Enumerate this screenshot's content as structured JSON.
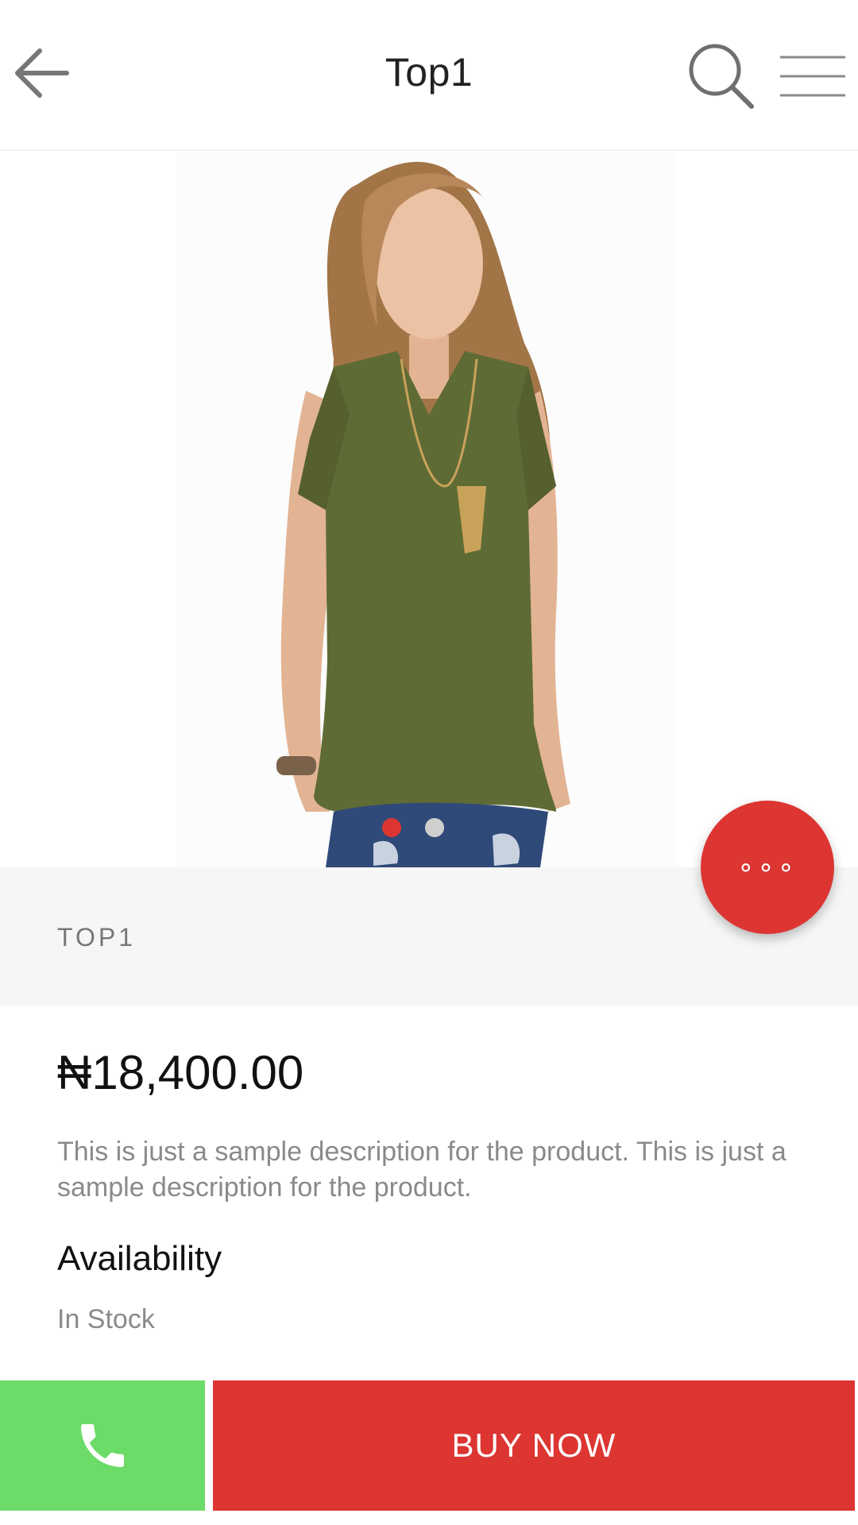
{
  "header": {
    "title": "Top1",
    "back_icon": "arrow-left-icon",
    "search_icon": "search-icon",
    "menu_icon": "hamburger-menu-icon"
  },
  "carousel": {
    "image_alt": "Woman wearing olive cold-shoulder top and ripped jeans",
    "slide_count": 2,
    "active_index": 0
  },
  "product": {
    "name": "TOP1",
    "price": "₦18,400.00",
    "description": "This is just a sample description for the product. This is just a sample description for the product.",
    "availability_heading": "Availability",
    "availability_value": "In Stock"
  },
  "fab": {
    "label": "∘∘∘",
    "icon": "more-options-icon"
  },
  "actions": {
    "call_icon": "phone-icon",
    "buy_label": "BUY NOW"
  },
  "colors": {
    "accent_red": "#dc3532",
    "call_green": "#6cdb68",
    "band_gray": "#f6f6f6",
    "text_muted": "#8a8a8a"
  }
}
